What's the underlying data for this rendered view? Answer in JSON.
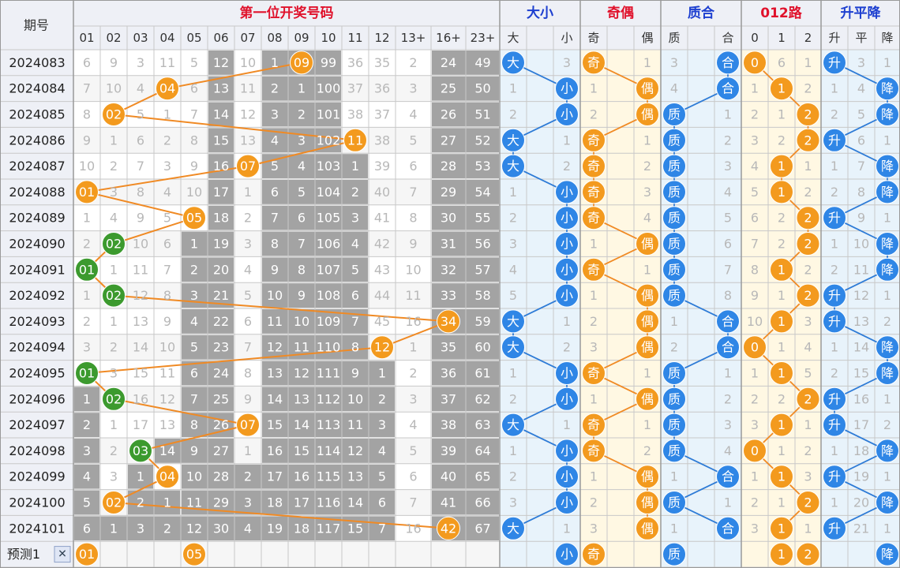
{
  "chart_data": {
    "type": "table",
    "headers": {
      "period": "期号",
      "group_titles": [
        "第一位开奖号码",
        "大小",
        "奇偶",
        "质合",
        "012路",
        "升平降"
      ],
      "number_cols": [
        "01",
        "02",
        "03",
        "04",
        "05",
        "06",
        "07",
        "08",
        "09",
        "10",
        "11",
        "12",
        "13+",
        "16+",
        "23+"
      ],
      "size_cols": [
        "大",
        "小"
      ],
      "parity_cols": [
        "奇",
        "偶"
      ],
      "prime_cols": [
        "质",
        "合"
      ],
      "mod_cols": [
        "0",
        "1",
        "2"
      ],
      "trend_cols": [
        "升",
        "平",
        "降"
      ]
    },
    "periods": [
      "2024083",
      "2024084",
      "2024085",
      "2024086",
      "2024087",
      "2024088",
      "2024089",
      "2024090",
      "2024091",
      "2024092",
      "2024093",
      "2024094",
      "2024095",
      "2024096",
      "2024097",
      "2024098",
      "2024099",
      "2024100",
      "2024101"
    ],
    "first_digit": [
      "09",
      "04",
      "02",
      "11",
      "07",
      "01",
      "05",
      "02",
      "01",
      "02",
      "16",
      "12",
      "01",
      "02",
      "07",
      "03",
      "04",
      "02",
      "16"
    ],
    "number_cells": [
      [
        "6",
        "9",
        "3",
        "11",
        "5",
        "12",
        "10",
        "1",
        "09",
        "99",
        "36",
        "35",
        "2",
        "24",
        "49"
      ],
      [
        "7",
        "10",
        "4",
        "04",
        "6",
        "13",
        "11",
        "2",
        "1",
        "100",
        "37",
        "36",
        "3",
        "25",
        "50"
      ],
      [
        "8",
        "02",
        "5",
        "1",
        "7",
        "14",
        "12",
        "3",
        "2",
        "101",
        "38",
        "37",
        "4",
        "26",
        "51"
      ],
      [
        "9",
        "1",
        "6",
        "2",
        "8",
        "15",
        "13",
        "4",
        "3",
        "102",
        "11",
        "38",
        "5",
        "27",
        "52"
      ],
      [
        "10",
        "2",
        "7",
        "3",
        "9",
        "16",
        "07",
        "5",
        "4",
        "103",
        "1",
        "39",
        "6",
        "28",
        "53"
      ],
      [
        "01",
        "3",
        "8",
        "4",
        "10",
        "17",
        "1",
        "6",
        "5",
        "104",
        "2",
        "40",
        "7",
        "29",
        "54"
      ],
      [
        "1",
        "4",
        "9",
        "5",
        "05",
        "18",
        "2",
        "7",
        "6",
        "105",
        "3",
        "41",
        "8",
        "30",
        "55"
      ],
      [
        "2",
        "02",
        "10",
        "6",
        "1",
        "19",
        "3",
        "8",
        "7",
        "106",
        "4",
        "42",
        "9",
        "31",
        "56"
      ],
      [
        "01",
        "1",
        "11",
        "7",
        "2",
        "20",
        "4",
        "9",
        "8",
        "107",
        "5",
        "43",
        "10",
        "32",
        "57"
      ],
      [
        "1",
        "02",
        "12",
        "8",
        "3",
        "21",
        "5",
        "10",
        "9",
        "108",
        "6",
        "44",
        "11",
        "33",
        "58"
      ],
      [
        "2",
        "1",
        "13",
        "9",
        "4",
        "22",
        "6",
        "11",
        "10",
        "109",
        "7",
        "45",
        "16",
        "34",
        "59"
      ],
      [
        "3",
        "2",
        "14",
        "10",
        "5",
        "23",
        "7",
        "12",
        "11",
        "110",
        "8",
        "12",
        "1",
        "35",
        "60"
      ],
      [
        "01",
        "3",
        "15",
        "11",
        "6",
        "24",
        "8",
        "13",
        "12",
        "111",
        "9",
        "1",
        "2",
        "36",
        "61"
      ],
      [
        "1",
        "02",
        "16",
        "12",
        "7",
        "25",
        "9",
        "14",
        "13",
        "112",
        "10",
        "2",
        "3",
        "37",
        "62"
      ],
      [
        "2",
        "1",
        "17",
        "13",
        "8",
        "26",
        "07",
        "15",
        "14",
        "113",
        "11",
        "3",
        "4",
        "38",
        "63"
      ],
      [
        "3",
        "2",
        "03",
        "14",
        "9",
        "27",
        "1",
        "16",
        "15",
        "114",
        "12",
        "4",
        "5",
        "39",
        "64"
      ],
      [
        "4",
        "3",
        "1",
        "04",
        "10",
        "28",
        "2",
        "17",
        "16",
        "115",
        "13",
        "5",
        "6",
        "40",
        "65"
      ],
      [
        "5",
        "02",
        "2",
        "1",
        "11",
        "29",
        "3",
        "18",
        "17",
        "116",
        "14",
        "6",
        "7",
        "41",
        "66"
      ],
      [
        "6",
        "1",
        "3",
        "2",
        "12",
        "30",
        "4",
        "19",
        "18",
        "117",
        "15",
        "7",
        "16",
        "42",
        "67"
      ]
    ],
    "size_cells": [
      [
        "大",
        "3"
      ],
      [
        "1",
        "小"
      ],
      [
        "2",
        "小"
      ],
      [
        "大",
        "1"
      ],
      [
        "大",
        "2"
      ],
      [
        "1",
        "小"
      ],
      [
        "2",
        "小"
      ],
      [
        "3",
        "小"
      ],
      [
        "4",
        "小"
      ],
      [
        "5",
        "小"
      ],
      [
        "大",
        "1"
      ],
      [
        "大",
        "2"
      ],
      [
        "1",
        "小"
      ],
      [
        "2",
        "小"
      ],
      [
        "大",
        "1"
      ],
      [
        "1",
        "小"
      ],
      [
        "2",
        "小"
      ],
      [
        "3",
        "小"
      ],
      [
        "大",
        "1"
      ]
    ],
    "parity_cells": [
      [
        "奇",
        "1"
      ],
      [
        "1",
        "偶"
      ],
      [
        "2",
        "偶"
      ],
      [
        "奇",
        "1"
      ],
      [
        "奇",
        "2"
      ],
      [
        "奇",
        "3"
      ],
      [
        "奇",
        "4"
      ],
      [
        "1",
        "偶"
      ],
      [
        "奇",
        "1"
      ],
      [
        "1",
        "偶"
      ],
      [
        "2",
        "偶"
      ],
      [
        "3",
        "偶"
      ],
      [
        "奇",
        "1"
      ],
      [
        "1",
        "偶"
      ],
      [
        "奇",
        "1"
      ],
      [
        "奇",
        "2"
      ],
      [
        "1",
        "偶"
      ],
      [
        "2",
        "偶"
      ],
      [
        "3",
        "偶"
      ]
    ],
    "prime_cells": [
      [
        "3",
        "合"
      ],
      [
        "4",
        "合"
      ],
      [
        "质",
        "1"
      ],
      [
        "质",
        "2"
      ],
      [
        "质",
        "3"
      ],
      [
        "质",
        "4"
      ],
      [
        "质",
        "5"
      ],
      [
        "质",
        "6"
      ],
      [
        "质",
        "7"
      ],
      [
        "质",
        "8"
      ],
      [
        "1",
        "合"
      ],
      [
        "2",
        "合"
      ],
      [
        "质",
        "1"
      ],
      [
        "质",
        "2"
      ],
      [
        "质",
        "3"
      ],
      [
        "质",
        "4"
      ],
      [
        "1",
        "合"
      ],
      [
        "质",
        "1"
      ],
      [
        "1",
        "合"
      ]
    ],
    "mod_cells": [
      [
        "0",
        "6",
        "1"
      ],
      [
        "1",
        "1",
        "2"
      ],
      [
        "2",
        "1",
        "2"
      ],
      [
        "3",
        "2",
        "2"
      ],
      [
        "4",
        "1",
        "1"
      ],
      [
        "5",
        "1",
        "2"
      ],
      [
        "6",
        "2",
        "2"
      ],
      [
        "7",
        "2",
        "2"
      ],
      [
        "8",
        "1",
        "2"
      ],
      [
        "9",
        "1",
        "2"
      ],
      [
        "10",
        "1",
        "3"
      ],
      [
        "0",
        "1",
        "4"
      ],
      [
        "1",
        "1",
        "5"
      ],
      [
        "2",
        "2",
        "2"
      ],
      [
        "3",
        "1",
        "1"
      ],
      [
        "0",
        "1",
        "2"
      ],
      [
        "1",
        "1",
        "3"
      ],
      [
        "2",
        "1",
        "2"
      ],
      [
        "3",
        "1",
        "1"
      ]
    ],
    "trend_cells": [
      [
        "升",
        "3",
        "1"
      ],
      [
        "1",
        "4",
        "降"
      ],
      [
        "2",
        "5",
        "降"
      ],
      [
        "升",
        "6",
        "1"
      ],
      [
        "1",
        "7",
        "降"
      ],
      [
        "2",
        "8",
        "降"
      ],
      [
        "升",
        "9",
        "1"
      ],
      [
        "1",
        "10",
        "降"
      ],
      [
        "2",
        "11",
        "降"
      ],
      [
        "升",
        "12",
        "1"
      ],
      [
        "升",
        "13",
        "2"
      ],
      [
        "1",
        "14",
        "降"
      ],
      [
        "2",
        "15",
        "降"
      ],
      [
        "升",
        "16",
        "1"
      ],
      [
        "升",
        "17",
        "2"
      ],
      [
        "1",
        "18",
        "降"
      ],
      [
        "升",
        "19",
        "1"
      ],
      [
        "1",
        "20",
        "降"
      ],
      [
        "升",
        "21",
        "1"
      ]
    ],
    "forecast": {
      "label": "预测1",
      "close_symbol": "✕",
      "numbers": [
        "01",
        "05"
      ],
      "size": [
        "小"
      ],
      "parity": [
        "奇"
      ],
      "prime": [
        "质"
      ],
      "mod": [
        "1",
        "2"
      ],
      "trend": [
        "降"
      ]
    },
    "colors": {
      "orange": "#f39a1e",
      "green": "#3c9a2e",
      "blue": "#2f86e6",
      "red_title": "#e0122c",
      "blue_title": "#1d3fd0",
      "gray_cell": "#a3a3a3",
      "line_orange": "#f08a24",
      "line_blue": "#2e7bd6"
    }
  }
}
